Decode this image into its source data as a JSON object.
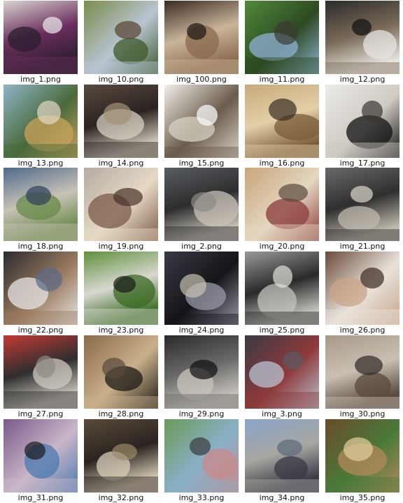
{
  "gallery": {
    "items": [
      {
        "filename": "img_1.png",
        "subject": "motorcycle-photo",
        "colors": [
          "#d9d4cf",
          "#2a1f2e",
          "#6b2e5e",
          "#eeeeee"
        ]
      },
      {
        "filename": "img_10.png",
        "subject": "park-crowd-photo",
        "colors": [
          "#7a8c4a",
          "#3d5a2a",
          "#b9c4d2",
          "#55402f"
        ]
      },
      {
        "filename": "img_100.png",
        "subject": "teddy-bear-photo",
        "colors": [
          "#3b2a22",
          "#8a6a4e",
          "#c9b49a",
          "#1b1512"
        ]
      },
      {
        "filename": "img_11.png",
        "subject": "cow-in-field-photo",
        "colors": [
          "#4f8a3a",
          "#8fb3d6",
          "#2d4a22",
          "#3b3b33"
        ]
      },
      {
        "filename": "img_12.png",
        "subject": "toilet-street-photo",
        "colors": [
          "#2b2b2b",
          "#e6e4df",
          "#7a6a58",
          "#0f0f0f"
        ]
      },
      {
        "filename": "img_13.png",
        "subject": "market-stall-photo",
        "colors": [
          "#8fb4c9",
          "#c9a35c",
          "#4a6a3a",
          "#e2d9c6"
        ]
      },
      {
        "filename": "img_14.png",
        "subject": "kitchen-dark-photo",
        "colors": [
          "#5a4a3e",
          "#d8cfc2",
          "#2a2420",
          "#a39176"
        ]
      },
      {
        "filename": "img_15.png",
        "subject": "white-kitchen-photo",
        "colors": [
          "#f2efe9",
          "#d8d2c6",
          "#6b5c4c",
          "#ffffff"
        ]
      },
      {
        "filename": "img_16.png",
        "subject": "fruit-still-life-photo",
        "colors": [
          "#c9a97a",
          "#7a5c3a",
          "#e2cfa8",
          "#3a2d22"
        ]
      },
      {
        "filename": "img_17.png",
        "subject": "cat-on-bed-photo",
        "colors": [
          "#ecebe8",
          "#121212",
          "#cfcac2",
          "#3a3632"
        ]
      },
      {
        "filename": "img_18.png",
        "subject": "tennis-court-photo",
        "colors": [
          "#4f6a8c",
          "#6a8a4a",
          "#c8c2b6",
          "#2f3f5a"
        ]
      },
      {
        "filename": "img_19.png",
        "subject": "food-plate-photo",
        "colors": [
          "#b4aba3",
          "#7a5a48",
          "#e6d9c4",
          "#4a3028"
        ]
      },
      {
        "filename": "img_2.png",
        "subject": "dog-in-car-photo",
        "colors": [
          "#5a5d60",
          "#c9c3b8",
          "#2c2d2f",
          "#8e8b86"
        ]
      },
      {
        "filename": "img_20.png",
        "subject": "kitchen-tins-photo",
        "colors": [
          "#c8a57a",
          "#8a3a3a",
          "#e4d6c0",
          "#5a4a3a"
        ]
      },
      {
        "filename": "img_21.png",
        "subject": "van-person-photo",
        "colors": [
          "#6a6a6a",
          "#bfb8ad",
          "#2f2f2f",
          "#e0d8cc"
        ]
      },
      {
        "filename": "img_22.png",
        "subject": "laptop-photo",
        "colors": [
          "#2b2b30",
          "#e6e6e6",
          "#9a7a5e",
          "#5a6a8a"
        ]
      },
      {
        "filename": "img_23.png",
        "subject": "dog-on-grass-photo",
        "colors": [
          "#5e8f3a",
          "#3a6a22",
          "#d8d8d0",
          "#1a1a1a"
        ]
      },
      {
        "filename": "img_24.png",
        "subject": "airplane-sky-photo",
        "colors": [
          "#3a3a44",
          "#9a9aa8",
          "#141418",
          "#c8c0b0"
        ]
      },
      {
        "filename": "img_25.png",
        "subject": "birds-on-water-photo",
        "colors": [
          "#9a9a98",
          "#c4c2bc",
          "#2a2a2a",
          "#e2e0da"
        ]
      },
      {
        "filename": "img_26.png",
        "subject": "cat-with-cup-photo",
        "colors": [
          "#6a4a3a",
          "#c9a48a",
          "#e8e2da",
          "#3a2a24"
        ]
      },
      {
        "filename": "img_27.png",
        "subject": "red-bus-photo",
        "colors": [
          "#c43a34",
          "#cfc9c0",
          "#2e2e2e",
          "#8e8a84"
        ]
      },
      {
        "filename": "img_28.png",
        "subject": "photo-collage-photo",
        "colors": [
          "#8a6a4a",
          "#1e1a17",
          "#c9b08a",
          "#5a4a3c"
        ]
      },
      {
        "filename": "img_29.png",
        "subject": "skateboard-ramp-photo",
        "colors": [
          "#2a2a2a",
          "#c8c4bc",
          "#6a6a6a",
          "#0e0e0e"
        ]
      },
      {
        "filename": "img_3.png",
        "subject": "double-decker-bus-photo",
        "colors": [
          "#3a3a44",
          "#b8c4d4",
          "#8e3a3a",
          "#5a5a64"
        ]
      },
      {
        "filename": "img_30.png",
        "subject": "street-sidewalk-photo",
        "colors": [
          "#a89a8a",
          "#5a4a40",
          "#c9bfb2",
          "#2e2a28"
        ]
      },
      {
        "filename": "img_31.png",
        "subject": "tennis-player-photo",
        "colors": [
          "#7a5a8a",
          "#4a7ab0",
          "#c9b6c8",
          "#1a1a1a"
        ]
      },
      {
        "filename": "img_32.png",
        "subject": "market-vendor-photo",
        "colors": [
          "#5a4a3a",
          "#d8cdb8",
          "#2a2420",
          "#9a8a6a"
        ]
      },
      {
        "filename": "img_33.png",
        "subject": "tennis-serve-photo",
        "colors": [
          "#6a9a5a",
          "#c88a8a",
          "#8ab0c8",
          "#3a3a3a"
        ]
      },
      {
        "filename": "img_34.png",
        "subject": "city-highway-photo",
        "colors": [
          "#8aa4c8",
          "#3a3a44",
          "#a8a6a2",
          "#5a6a7a"
        ]
      },
      {
        "filename": "img_35.png",
        "subject": "giraffe-photo",
        "colors": [
          "#6a4a2a",
          "#b48a5a",
          "#4a7a3a",
          "#e2cfa0"
        ]
      }
    ]
  }
}
